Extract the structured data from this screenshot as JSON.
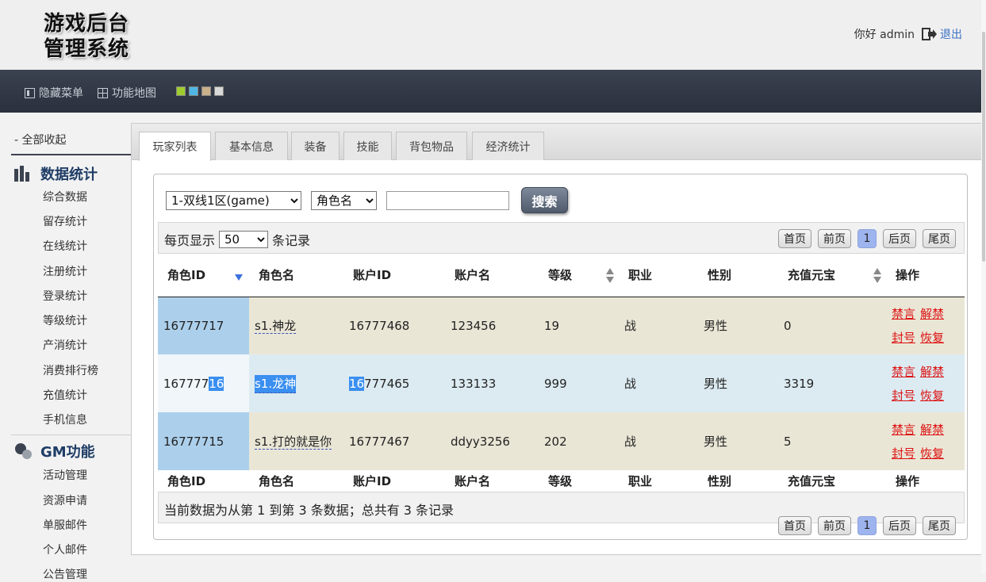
{
  "header": {
    "logo_line1": "游戏后台",
    "logo_line2": "管理系统",
    "greeting": "你好 admin",
    "logout": "退出"
  },
  "navbar": {
    "hide_menu": "隐藏菜单",
    "site_map": "功能地图",
    "theme_colors": [
      "#9fcc2e",
      "#4fb6e6",
      "#c9b08a",
      "#d9d9d9"
    ]
  },
  "sidebar": {
    "collapse_all": "- 全部收起",
    "sections": [
      {
        "title": "数据统计",
        "icon": "bar-chart-icon",
        "items": [
          "综合数据",
          "留存统计",
          "在线统计",
          "注册统计",
          "登录统计",
          "等级统计",
          "产消统计",
          "消费排行榜",
          "充值统计",
          "手机信息"
        ]
      },
      {
        "title": "GM功能",
        "icon": "gm-icon",
        "items": [
          "活动管理",
          "资源申请",
          "单服邮件",
          "个人邮件",
          "公告管理"
        ]
      }
    ]
  },
  "tabs": [
    "玩家列表",
    "基本信息",
    "装备",
    "技能",
    "背包物品",
    "经济统计"
  ],
  "filters": {
    "server": "1-双线1区(game)",
    "field": "角色名",
    "search_value": "",
    "search_button": "搜索"
  },
  "table_controls": {
    "page_size_prefix": "每页显示",
    "page_size": "50",
    "page_size_suffix": "条记录",
    "pager": {
      "first": "首页",
      "prev": "前页",
      "current": "1",
      "next": "后页",
      "last": "尾页"
    }
  },
  "table": {
    "columns": [
      "角色ID",
      "角色名",
      "账户ID",
      "账户名",
      "等级",
      "职业",
      "性别",
      "充值元宝",
      "操作"
    ],
    "rows": [
      {
        "id": "16777717",
        "name": "s1.神龙",
        "account_id": "16777468",
        "account": "123456",
        "level": "19",
        "job": "战",
        "gender": "男性",
        "gold": "0"
      },
      {
        "id_a": "167777",
        "id_b": "16",
        "name": "s1.龙神",
        "account_id_a": "16",
        "account_id_b": "777465",
        "account": "133133",
        "level": "999",
        "job": "战",
        "gender": "男性",
        "gold": "3319"
      },
      {
        "id": "16777715",
        "name": "s1.打的就是你",
        "account_id": "16777467",
        "account": "ddyy3256",
        "level": "202",
        "job": "战",
        "gender": "男性",
        "gold": "5"
      }
    ],
    "actions": {
      "mute": "禁言",
      "unmute": "解禁",
      "ban": "封号",
      "restore": "恢复"
    }
  },
  "info": "当前数据为从第 1 到第 3 条数据；总共有 3 条记录"
}
